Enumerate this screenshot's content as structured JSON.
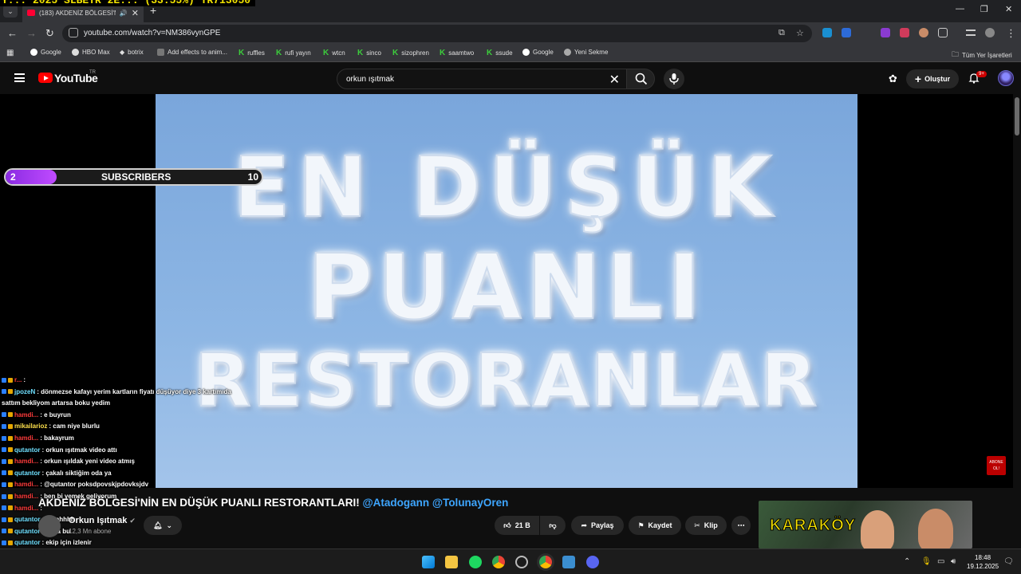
{
  "overlay": {
    "ticker": "Y... 2025 SLBETR 2E... (33.55%)   TR713050",
    "subgoal": {
      "current": "2",
      "label": "SUBSCRIBERS",
      "goal": "10",
      "progress": 0.2
    },
    "abone_badge": "ABONE OL!"
  },
  "browser": {
    "tab_title": "(183) AKDENİZ BÖLGESİ'Nİ",
    "url": "youtube.com/watch?v=NM386vynGPE",
    "bookmarks": [
      "Google",
      "HBO Max",
      "botrix",
      "Add effects to anim...",
      "ruffles",
      "rufi yayın",
      "wtcn",
      "sinco",
      "sizophren",
      "saamtwo",
      "ssude",
      "Google",
      "Yeni Sekme"
    ],
    "all_bookmarks": "Tüm Yer İşaretleri"
  },
  "youtube": {
    "logo": "YouTube",
    "country": "TR",
    "search_query": "orkun ışıtmak",
    "create_label": "Oluştur",
    "notification_count": "9+"
  },
  "video": {
    "cloud_lines": [
      "EN DÜŞÜK",
      "PUANLI",
      "RESTORANLAR"
    ],
    "title": "AKDENİZ BÖLGESİ'NİN EN DÜŞÜK PUANLI RESTORANTLARI!",
    "title_tags": "@Atadogann @TolunayOren",
    "channel_name": "Orkun Işıtmak",
    "channel_subs": "12,3 Mn abone",
    "likes": "21 B",
    "share_label": "Paylaş",
    "save_label": "Kaydet",
    "clip_label": "Klip",
    "next_thumb_text": "KARAKÖY"
  },
  "chat": [
    {
      "user": "r...",
      "text": ":",
      "color": "#ff3b3b"
    },
    {
      "user": "jpozeN",
      "text": ": dönmezse kafayı yerim kartların fiyatı düşüyor diye 3 kartımıda",
      "color": "#6fe0ff"
    },
    {
      "user": "",
      "text": "sattım bekliyom artarsa boku yedim",
      "color": "#ffffff"
    },
    {
      "user": "hamdi...",
      "text": ": e buyrun",
      "color": "#ff3b3b"
    },
    {
      "user": "mikailarioz",
      "text": ": cam niye blurlu",
      "color": "#ffe14d"
    },
    {
      "user": "hamdi...",
      "text": ": bakayrum",
      "color": "#ff3b3b"
    },
    {
      "user": "qutantor",
      "text": ": orkun ışıtmak video attı",
      "color": "#6fe0ff"
    },
    {
      "user": "hamdi...",
      "text": ": orkun ışıldak yeni video atmış",
      "color": "#ff3b3b"
    },
    {
      "user": "qutantor",
      "text": ": çakalı siktiğim oda ya",
      "color": "#6fe0ff"
    },
    {
      "user": "hamdi...",
      "text": ": @qutantor poksdpovskjpdovksjdv",
      "color": "#ff3b3b"
    },
    {
      "user": "hamdi...",
      "text": ": ben bi yemek geliyorum",
      "color": "#ff3b3b"
    },
    {
      "user": "hamdi...",
      "text": ":",
      "color": "#ff3b3b"
    },
    {
      "user": "qutantor",
      "text": ": darahhhh",
      "color": "#6fe0ff"
    },
    {
      "user": "qutantor",
      "text": ": bu la bu",
      "color": "#6fe0ff"
    },
    {
      "user": "qutantor",
      "text": ": ekip için izlenir",
      "color": "#6fe0ff"
    }
  ],
  "taskbar": {
    "time": "18:48",
    "date": "19.12.2025"
  }
}
